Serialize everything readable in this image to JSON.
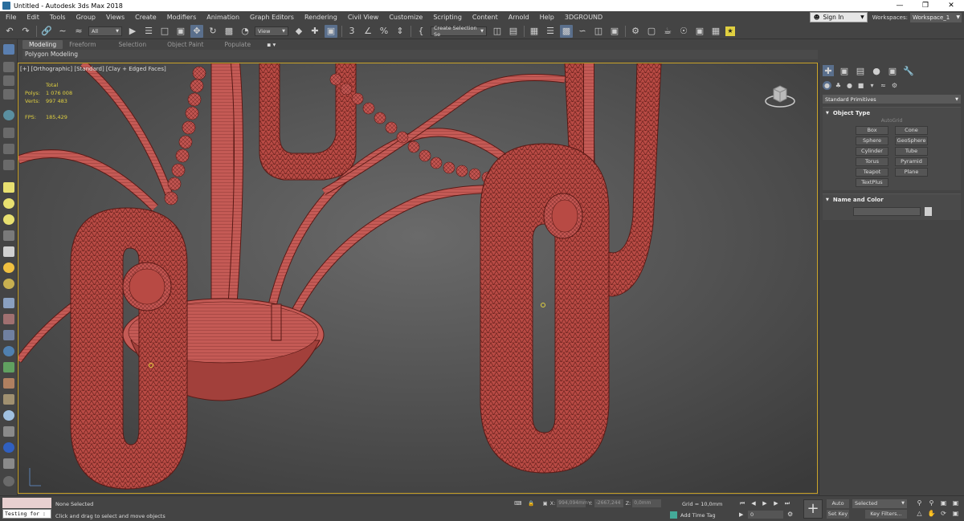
{
  "window": {
    "title": "Untitled - Autodesk 3ds Max 2018",
    "min": "—",
    "max": "❐",
    "close": "✕"
  },
  "menu": [
    "File",
    "Edit",
    "Tools",
    "Group",
    "Views",
    "Create",
    "Modifiers",
    "Animation",
    "Graph Editors",
    "Rendering",
    "Civil View",
    "Customize",
    "Scripting",
    "Content",
    "Arnold",
    "Help",
    "3DGROUND"
  ],
  "account": {
    "sign_in": "Sign In",
    "workspaces_label": "Workspaces:",
    "workspace": "Workspace_1"
  },
  "toolbar": {
    "filter": "All",
    "ref_coord": "View",
    "selection_set": "Create Selection Se"
  },
  "ribbon": {
    "tabs": [
      "Modeling",
      "Freeform",
      "Selection",
      "Object Paint",
      "Populate"
    ],
    "panel": "Polygon Modeling"
  },
  "viewport": {
    "label": "[+] [Orthographic] [Standard] [Clay + Edged Faces]",
    "stats": {
      "total_label": "Total",
      "polys_label": "Polys:",
      "polys": "1 076 008",
      "verts_label": "Verts:",
      "verts": "997 483",
      "fps_label": "FPS:",
      "fps": "185,429"
    }
  },
  "command_panel": {
    "category": "Standard Primitives",
    "object_type": {
      "title": "Object Type",
      "autogrid": "AutoGrid",
      "buttons": [
        "Box",
        "Cone",
        "Sphere",
        "GeoSphere",
        "Cylinder",
        "Tube",
        "Torus",
        "Pyramid",
        "Teapot",
        "Plane",
        "TextPlus"
      ]
    },
    "name_color": {
      "title": "Name and Color"
    }
  },
  "status": {
    "listener": "Testing for :",
    "selection": "None Selected",
    "prompt": "Click and drag to select and move objects",
    "x_label": "X:",
    "x": "994,094mm",
    "y_label": "Y:",
    "y": "-2667,244",
    "z_label": "Z:",
    "z": "0,0mm",
    "grid": "Grid = 10,0mm",
    "add_time_tag": "Add Time Tag",
    "frame": "0",
    "auto_key": "Auto Key",
    "set_key": "Set Key",
    "key_mode": "Selected",
    "key_filters": "Key Filters..."
  },
  "colors": {
    "accent": "#5a6f8c",
    "viewport_border": "#c9a227",
    "stats_text": "#e0d040",
    "mesh": "#b84a44"
  },
  "icons": [
    "undo-icon",
    "redo-icon",
    "link-icon",
    "unlink-icon",
    "bind-space-warp-icon",
    "select-object-icon",
    "select-by-name-icon",
    "rect-region-icon",
    "window-crossing-icon",
    "move-icon",
    "rotate-icon",
    "scale-icon",
    "placement-icon",
    "pivot-icon",
    "snap-3d-icon",
    "angle-snap-icon",
    "percent-snap-icon",
    "spinner-snap-icon",
    "edit-named-sets-icon",
    "mirror-icon",
    "align-icon",
    "scene-explorer-icon",
    "layer-explorer-icon",
    "ribbon-toggle-icon",
    "curve-editor-icon",
    "schematic-view-icon",
    "material-editor-icon",
    "render-setup-icon",
    "render-frame-icon",
    "render-icon",
    "3dground-icon"
  ]
}
